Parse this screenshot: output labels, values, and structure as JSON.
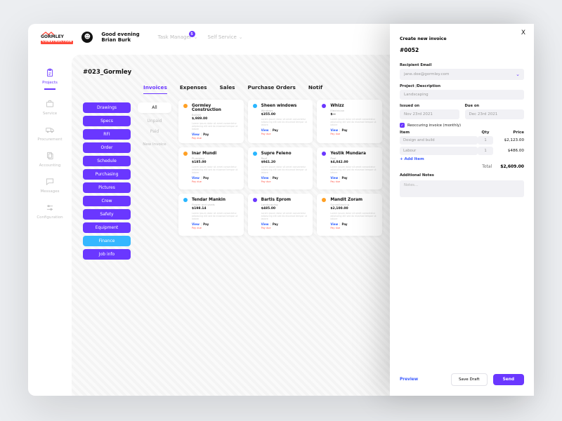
{
  "brand": {
    "name": "GORMLEY",
    "sub": "CONSTRUCTION"
  },
  "header": {
    "greeting_line1": "Good evening",
    "greeting_line2": "Brian Burk",
    "task_manager": "Task Manager",
    "task_badge": "5",
    "self_service": "Self Service"
  },
  "sidebar": {
    "items": [
      {
        "label": "Projects"
      },
      {
        "label": "Service"
      },
      {
        "label": "Procurement"
      },
      {
        "label": "Accounting"
      },
      {
        "label": "Messages"
      },
      {
        "label": "Configuration"
      }
    ]
  },
  "project": {
    "title": "#023_Gormley"
  },
  "chips": [
    "Drawings",
    "Specs",
    "RFI",
    "Order",
    "Schedule",
    "Purchasing",
    "Pictures",
    "Crew",
    "Safety",
    "Equipment",
    "Finance",
    "Job info"
  ],
  "tabs": [
    "Invoices",
    "Expenses",
    "Sales",
    "Purchase Orders",
    "Notif"
  ],
  "filters": {
    "all": "All",
    "unpaid": "Unpaid",
    "paid": "Paid",
    "new": "New Invoice"
  },
  "cards": [
    {
      "color": "orange",
      "name": "Gormley Construction",
      "meta": "Builder",
      "amt": "$,989.00",
      "due": "Pay due"
    },
    {
      "color": "blue",
      "name": "Sheen windows",
      "meta": "Windows",
      "amt": "$355.00",
      "due": "Pay due"
    },
    {
      "color": "purple",
      "name": "Whizz",
      "meta": "Electrician",
      "amt": "$—",
      "due": "Pay due"
    },
    {
      "color": "orange",
      "name": "Inar Mundi",
      "meta": "Plumbing",
      "amt": "$185.00",
      "due": "Pay due"
    },
    {
      "color": "blue",
      "name": "Supre Feleno",
      "meta": "Roof",
      "amt": "$941.20",
      "due": "Pay due"
    },
    {
      "color": "purple",
      "name": "Yestik Mundara",
      "meta": "Pool",
      "amt": "$4,042.00",
      "due": "Pay due"
    },
    {
      "color": "blue",
      "name": "Tendar Mankin",
      "meta": "Flower and yards",
      "amt": "$198.14",
      "due": "Pay due"
    },
    {
      "color": "purple",
      "name": "Bartis Eprom",
      "meta": "Landscaping",
      "amt": "$485.00",
      "due": "Pay due"
    },
    {
      "color": "orange",
      "name": "Mandit Zoram",
      "meta": "Surveillancing",
      "amt": "$2,100.00",
      "due": "Pay due"
    }
  ],
  "card_actions": {
    "view": "View",
    "pay": "Pay"
  },
  "card_desc": "Lorem ipsum dolor sit amet consectetur adipiscing elit sed do eiusmod tempor ut labore",
  "drawer": {
    "close": "X",
    "title": "Create new invoice",
    "number": "#0052",
    "email_label": "Recipient Email",
    "email_value": "jane.doe@gormley.com",
    "proj_label": "Project /Description",
    "proj_value": "Landscaping",
    "issued_label": "Issued on",
    "issued_value": "Nov 23rd 2021",
    "due_label": "Due on",
    "due_value": "Dec 23rd 2021",
    "recurring": "Reoccuring invoice (monthly)",
    "col_item": "Item",
    "col_qty": "Qty",
    "col_price": "Price",
    "items": [
      {
        "name": "Design and build",
        "qty": "1",
        "price": "$2,123.00"
      },
      {
        "name": "Labour",
        "qty": "1",
        "price": "$486.00"
      }
    ],
    "add_item": "+ Add Item",
    "total_label": "Total",
    "total_value": "$2,609.00",
    "notes_label": "Additional Notes",
    "notes_placeholder": "Notes…",
    "preview": "Preview",
    "save_draft": "Save Draft",
    "send": "Send"
  }
}
